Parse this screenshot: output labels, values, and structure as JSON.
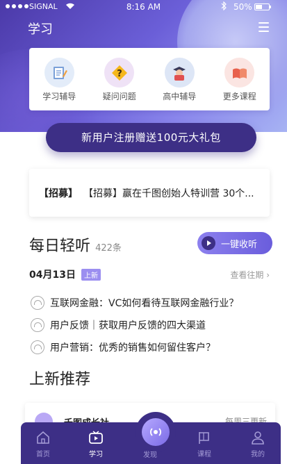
{
  "status_bar": {
    "carrier": "SIGNAL",
    "time": "8:16 AM",
    "battery": "50%"
  },
  "header": {
    "title": "学习"
  },
  "quick_nav": [
    {
      "label": "学习辅导",
      "icon": "notebook-icon",
      "bg": "#e3ecf9"
    },
    {
      "label": "疑问问题",
      "icon": "question-icon",
      "bg": "#efe2f6"
    },
    {
      "label": "高中辅导",
      "icon": "student-icon",
      "bg": "#dde6f6"
    },
    {
      "label": "更多课程",
      "icon": "book-icon",
      "bg": "#fbe5e2"
    }
  ],
  "promo": {
    "label": "新用户注册赠送100元大礼包"
  },
  "recruit": {
    "tag": "【招募】",
    "text": "【招募】赢在千图创始人特训营 30个..."
  },
  "daily": {
    "title": "每日轻听",
    "count": "422条",
    "listen_button": "一键收听",
    "date": "04月13日",
    "new_badge": "上新",
    "past_link": "查看往期 ›",
    "items": [
      {
        "text": "互联网金融：VC如何看待互联网金融行业？"
      },
      {
        "text": "用户反馈｜获取用户反馈的四大渠道"
      },
      {
        "text": "用户营销：优秀的销售如何留住客户？"
      }
    ]
  },
  "recommend": {
    "title": "上新推荐",
    "card_name": "千图成长社",
    "card_freq": "每周三更新"
  },
  "tabbar": {
    "home": "首页",
    "study": "学习",
    "discover": "发现",
    "course": "课程",
    "mine": "我的"
  },
  "colors": {
    "brand": "#3d2f86",
    "accent": "#6a5ddc",
    "badge": "#9b8ef0"
  }
}
